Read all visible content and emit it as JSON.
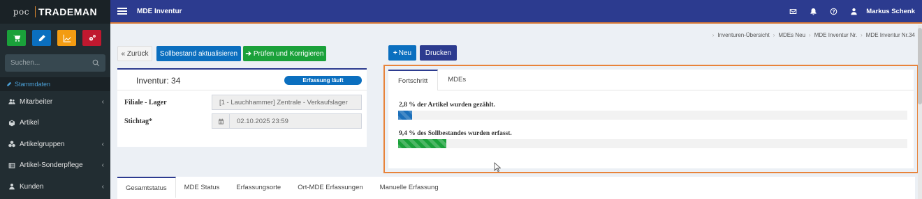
{
  "app": {
    "logo_poc": "poc",
    "logo_brand": "TRADEMAN"
  },
  "sidebar": {
    "quick_buttons": [
      {
        "icon": "cart-icon",
        "color": "#1aa13a"
      },
      {
        "icon": "pencil-icon",
        "color": "#0b6fbf"
      },
      {
        "icon": "chart-icon",
        "color": "#f39c12"
      },
      {
        "icon": "cogs-icon",
        "color": "#c0182f"
      }
    ],
    "search_placeholder": "Suchen...",
    "section_label": "Stammdaten",
    "items": [
      {
        "label": "Mitarbeiter",
        "icon": "users-icon",
        "has_submenu": true
      },
      {
        "label": "Artikel",
        "icon": "cube-icon",
        "has_submenu": false
      },
      {
        "label": "Artikelgruppen",
        "icon": "cubes-icon",
        "has_submenu": true
      },
      {
        "label": "Artikel-Sonderpflege",
        "icon": "list-icon",
        "has_submenu": true
      },
      {
        "label": "Kunden",
        "icon": "user-icon",
        "has_submenu": true
      }
    ]
  },
  "header": {
    "title": "MDE Inventur",
    "user_name": "Markus Schenk"
  },
  "breadcrumb": [
    "Inventuren-Übersicht",
    "MDEs Neu",
    "MDE Inventur Nr.",
    "MDE Inventur Nr.34"
  ],
  "actions": {
    "back": "« Zurück",
    "update_stock": "Sollbestand aktualisieren",
    "check": "Prüfen und Korrigieren",
    "new": "Neu",
    "print": "Drucken"
  },
  "inventory": {
    "title": "Inventur: 34",
    "status": "Erfassung läuft",
    "branch_label": "Filiale - Lager",
    "branch_value": "[1 - Lauchhammer] Zentrale - Verkaufslager",
    "date_label": "Stichtag*",
    "date_value": "02.10.2025 23:59"
  },
  "progress": {
    "tabs": [
      "Fortschritt",
      "MDEs"
    ],
    "active_tab": "Fortschritt",
    "items": [
      {
        "label": "2,8 % der Artikel wurden gezählt.",
        "percent": 2.8,
        "color": "#1b6fba"
      },
      {
        "label": "9,4 % des Sollbestandes wurden erfasst.",
        "percent": 9.4,
        "color": "#1aa13a"
      }
    ]
  },
  "bottom_tabs": [
    "Gesamtstatus",
    "MDE Status",
    "Erfassungsorte",
    "Ort-MDE Erfassungen",
    "Manuelle Erfassung"
  ],
  "colors": {
    "header": "#2c3b8f",
    "accent_orange": "#e8833a",
    "sidebar": "#222d32"
  }
}
